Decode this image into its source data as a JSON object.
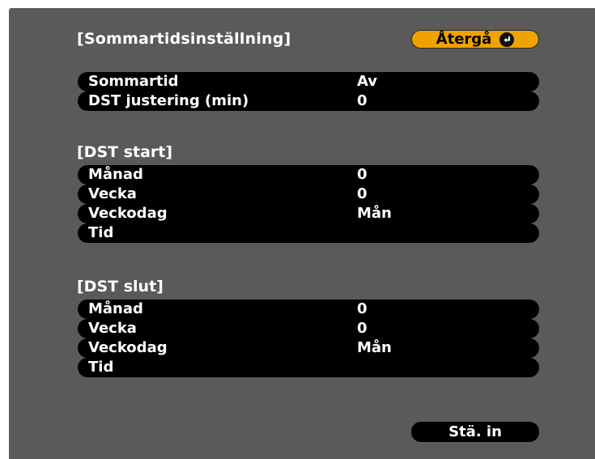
{
  "header": {
    "title": "[Sommartidsinställning]",
    "back_label": "Återgå",
    "back_icon": "enter-icon"
  },
  "settings": [
    {
      "label": "Sommartid",
      "value": "Av"
    },
    {
      "label": "DST justering (min)",
      "value": "0"
    }
  ],
  "dst_start": {
    "heading": "[DST start]",
    "rows": [
      {
        "label": "Månad",
        "value": "0"
      },
      {
        "label": "Vecka",
        "value": "0"
      },
      {
        "label": "Veckodag",
        "value": "Mån"
      },
      {
        "label": "Tid",
        "value": ""
      }
    ]
  },
  "dst_end": {
    "heading": "[DST slut]",
    "rows": [
      {
        "label": "Månad",
        "value": "0"
      },
      {
        "label": "Vecka",
        "value": "0"
      },
      {
        "label": "Veckodag",
        "value": "Mån"
      },
      {
        "label": "Tid",
        "value": ""
      }
    ]
  },
  "footer": {
    "set_label": "Stä. in"
  },
  "colors": {
    "panel_bg": "#5a5a5a",
    "row_bg": "#000000",
    "accent": "#f0a200",
    "text": "#ffffff"
  }
}
